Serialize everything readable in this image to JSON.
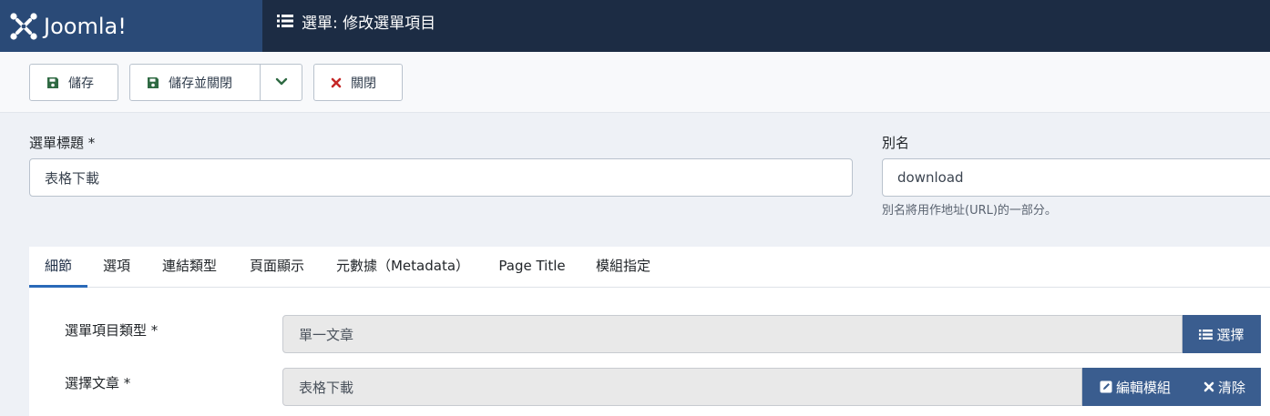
{
  "header": {
    "logo_text": "Joomla!",
    "page_title": "選單: 修改選單項目",
    "brand_color": "#2a4a77",
    "header_color": "#1c2c44"
  },
  "toolbar": {
    "save_label": "儲存",
    "save_close_label": "儲存並關閉",
    "close_label": "關閉"
  },
  "form": {
    "title_label": "選單標題 *",
    "title_value": "表格下載",
    "alias_label": "別名",
    "alias_value": "download",
    "alias_help": "別名將用作地址(URL)的一部分。"
  },
  "tabs": [
    {
      "label": "細節",
      "active": true
    },
    {
      "label": "選項"
    },
    {
      "label": "連結類型"
    },
    {
      "label": "頁面顯示"
    },
    {
      "label": "元數據（Metadata）"
    },
    {
      "label": "Page Title"
    },
    {
      "label": "模組指定"
    }
  ],
  "details": {
    "type_label": "選單項目類型 *",
    "type_value": "單一文章",
    "select_button": "選擇",
    "article_label": "選擇文章 *",
    "article_value": "表格下載",
    "edit_module_button": "編輯模組",
    "clear_button": "清除"
  },
  "colors": {
    "accent": "#2a69b8",
    "button_blue": "#3a5d8f",
    "save_green": "#2f6a43",
    "close_red": "#c52827"
  }
}
